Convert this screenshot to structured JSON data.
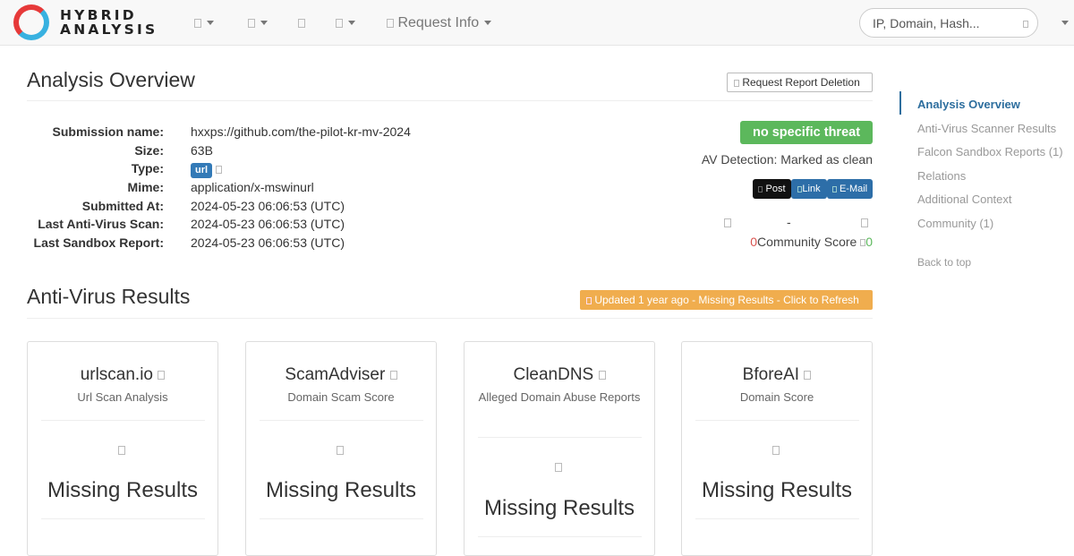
{
  "navbar": {
    "logo_line1": "HYBRID",
    "logo_line2": "ANALYSIS",
    "request_info": "Request Info",
    "search_placeholder": "IP, Domain, Hash..."
  },
  "overview": {
    "title": "Analysis Overview",
    "delete_button": "Request Report Deletion",
    "fields": [
      {
        "label": "Submission name:",
        "value": "hxxps://github.com/the-pilot-kr-mv-2024"
      },
      {
        "label": "Size:",
        "value": "63B"
      },
      {
        "label": "Type:",
        "value": "url"
      },
      {
        "label": "Mime:",
        "value": "application/x-mswinurl"
      },
      {
        "label": "Submitted At:",
        "value": "2024-05-23 06:06:53 (UTC)"
      },
      {
        "label": "Last Anti-Virus Scan:",
        "value": "2024-05-23 06:06:53 (UTC)"
      },
      {
        "label": "Last Sandbox Report:",
        "value": "2024-05-23 06:06:53 (UTC)"
      }
    ],
    "threat_badge": "no specific threat",
    "av_detection": "AV Detection: Marked as clean",
    "share": {
      "post": "Post",
      "link": "Link",
      "email": "E-Mail"
    },
    "community": {
      "dash": "-",
      "down": "0",
      "label": "Community Score",
      "up": "0"
    }
  },
  "antivirus": {
    "title": "Anti-Virus Results",
    "refresh": "Updated 1 year ago - Missing Results - Click to Refresh",
    "cards": [
      {
        "name": "urlscan.io",
        "sub": "Url Scan Analysis",
        "result": "Missing Results"
      },
      {
        "name": "ScamAdviser",
        "sub": "Domain Scam Score",
        "result": "Missing Results"
      },
      {
        "name": "CleanDNS",
        "sub": "Alleged Domain Abuse Reports",
        "result": "Missing Results"
      },
      {
        "name": "BforeAI",
        "sub": "Domain Score",
        "result": "Missing Results"
      }
    ]
  },
  "sidebar": {
    "items": [
      "Analysis Overview",
      "Anti-Virus Scanner Results",
      "Falcon Sandbox Reports (1)",
      "Relations",
      "Additional Context",
      "Community (1)"
    ],
    "back_to_top": "Back to top"
  },
  "colors": {
    "accent": "#2d6e9e",
    "threat_green": "#5cb85c",
    "refresh_orange": "#f0ad4e",
    "url_badge": "#337ab7"
  }
}
